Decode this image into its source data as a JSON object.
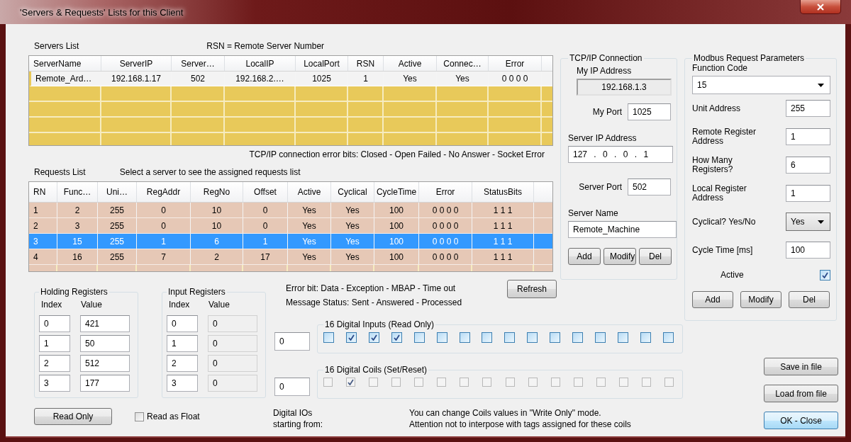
{
  "window": {
    "title": "'Servers & Requests' Lists for this Client"
  },
  "servers": {
    "label": "Servers List",
    "note": "RSN = Remote Server Number",
    "columns": [
      "ServerName",
      "ServerIP",
      "Server…",
      "LocalIP",
      "LocalPort",
      "RSN",
      "Active",
      "Connec…",
      "Error"
    ],
    "rows": [
      {
        "cells": [
          "Remote_Ard…",
          "192.168.1.17",
          "502",
          "192.168.2.…",
          "1025",
          "1",
          "Yes",
          "Yes",
          "0 0 0 0"
        ],
        "selected": false
      }
    ],
    "error_bits_note": "TCP/IP connection error bits: Closed - Open Failed - No Answer - Socket Error"
  },
  "requests": {
    "label": "Requests List",
    "hint": "Select a server to see the assigned requests list",
    "columns": [
      "RN",
      "Func…",
      "Uni…",
      "RegAddr",
      "RegNo",
      "Offset",
      "Active",
      "Cyclical",
      "CycleTime",
      "Error",
      "StatusBits"
    ],
    "rows": [
      {
        "cells": [
          "1",
          "2",
          "255",
          "0",
          "10",
          "0",
          "Yes",
          "Yes",
          "100",
          "0 0 0 0",
          "1 1 1"
        ],
        "selected": false
      },
      {
        "cells": [
          "2",
          "3",
          "255",
          "0",
          "10",
          "0",
          "Yes",
          "Yes",
          "100",
          "0 0 0 0",
          "1 1 1"
        ],
        "selected": false
      },
      {
        "cells": [
          "3",
          "15",
          "255",
          "1",
          "6",
          "1",
          "Yes",
          "Yes",
          "100",
          "0 0 0 0",
          "1 1 1"
        ],
        "selected": true
      },
      {
        "cells": [
          "4",
          "16",
          "255",
          "7",
          "2",
          "17",
          "Yes",
          "Yes",
          "100",
          "0 0 0 0",
          "1 1 1"
        ],
        "selected": false
      }
    ]
  },
  "tcp_ip": {
    "title": "TCP/IP Connection",
    "my_ip_label": "My IP Address",
    "my_ip": "192.168.1.3",
    "my_port_label": "My Port",
    "my_port": "1025",
    "server_ip_label": "Server IP Address",
    "server_ip": "127 . 0 . 0 . 1",
    "server_port_label": "Server Port",
    "server_port": "502",
    "server_name_label": "Server Name",
    "server_name": "Remote_Machine",
    "buttons": [
      "Add",
      "Modify",
      "Del"
    ]
  },
  "modbus": {
    "title": "Modbus Request Parameters",
    "function_code_label": "Function Code",
    "function_code": "15",
    "fields": [
      {
        "kind": "text",
        "label": "Unit Address",
        "value": "255"
      },
      {
        "kind": "text",
        "label": "Remote Register Address",
        "value": "1"
      },
      {
        "kind": "text",
        "label": "How Many Registers?",
        "value": "6"
      },
      {
        "kind": "text",
        "label": "Local Register Address",
        "value": "1"
      },
      {
        "kind": "dropdown",
        "label": "Cyclical? Yes/No",
        "value": "Yes"
      },
      {
        "kind": "text",
        "label": "Cycle Time [ms]",
        "value": "100"
      },
      {
        "kind": "checkbox",
        "label": "Active",
        "checked": true
      }
    ],
    "buttons": [
      "Add",
      "Modify",
      "Del"
    ]
  },
  "info": {
    "error_bit": "Error bit:  Data - Exception - MBAP - Time out",
    "message_status": "Message Status:  Sent - Answered - Processed",
    "refresh": "Refresh"
  },
  "holding_registers": {
    "title": "Holding Registers",
    "index_label": "Index",
    "value_label": "Value",
    "disabled": false,
    "rows": [
      {
        "index": "0",
        "value": "421"
      },
      {
        "index": "1",
        "value": "50"
      },
      {
        "index": "2",
        "value": "512"
      },
      {
        "index": "3",
        "value": "177"
      }
    ]
  },
  "input_registers": {
    "title": "Input Registers",
    "index_label": "Index",
    "value_label": "Value",
    "disabled": true,
    "rows": [
      {
        "index": "0",
        "value": "0"
      },
      {
        "index": "1",
        "value": "0"
      },
      {
        "index": "2",
        "value": "0"
      },
      {
        "index": "3",
        "value": "0"
      }
    ]
  },
  "read_only_button": "Read Only",
  "read_as_float": {
    "label": "Read as Float",
    "checked": false
  },
  "digital_inputs": {
    "start": "0",
    "title": "16 Digital Inputs (Read Only)",
    "disabled": false,
    "bits": [
      {
        "checked": false
      },
      {
        "checked": true
      },
      {
        "checked": true
      },
      {
        "checked": true
      },
      {
        "checked": false
      },
      {
        "checked": false
      },
      {
        "checked": false
      },
      {
        "checked": false
      },
      {
        "checked": false
      },
      {
        "checked": false
      },
      {
        "checked": false
      },
      {
        "checked": false
      },
      {
        "checked": false
      },
      {
        "checked": false
      },
      {
        "checked": false
      },
      {
        "checked": false
      }
    ]
  },
  "digital_coils": {
    "start": "0",
    "title": "16 Digital Coils (Set/Reset)",
    "disabled": true,
    "bits": [
      {
        "checked": false
      },
      {
        "checked": true
      },
      {
        "checked": false
      },
      {
        "checked": false
      },
      {
        "checked": false
      },
      {
        "checked": false
      },
      {
        "checked": false
      },
      {
        "checked": false
      },
      {
        "checked": false
      },
      {
        "checked": false
      },
      {
        "checked": false
      },
      {
        "checked": false
      },
      {
        "checked": false
      },
      {
        "checked": false
      },
      {
        "checked": false
      },
      {
        "checked": false
      }
    ]
  },
  "digital_start_label": [
    "Digital IOs",
    "starting  from:"
  ],
  "coils_note": [
    "You can change Coils values in \"Write Only\" mode.",
    "Attention not to interpose with tags assigned for these coils"
  ],
  "buttons": [
    {
      "label": "Save in file",
      "default": false
    },
    {
      "label": "Load from file",
      "default": false
    },
    {
      "label": "OK - Close",
      "default": true
    }
  ]
}
